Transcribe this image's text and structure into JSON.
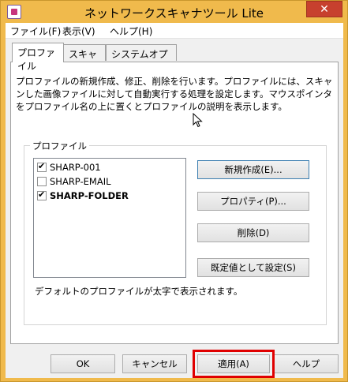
{
  "window": {
    "title": "ネットワークスキャナツール Lite",
    "close_label": "✕"
  },
  "menu": [
    "ファイル(F)",
    "表示(V)",
    "ヘルプ(H)"
  ],
  "tabs": [
    "プロファイル",
    "スキャナ",
    "システムオプション"
  ],
  "profile_tab": {
    "description": "プロファイルの新規作成、修正、削除を行います。プロファイルには、スキャンした画像ファイルに対して自動実行する処理を設定します。マウスポインタをプロファイル名の上に置くとプロファイルの説明を表示します。",
    "group_label": "プロファイル",
    "profiles": [
      {
        "name": "SHARP-001",
        "checked": true,
        "bold": false
      },
      {
        "name": "SHARP-EMAIL",
        "checked": false,
        "bold": false
      },
      {
        "name": "SHARP-FOLDER",
        "checked": true,
        "bold": true
      }
    ],
    "buttons": {
      "new": "新規作成(E)...",
      "properties": "プロパティ(P)...",
      "delete": "削除(D)",
      "set_default": "既定値として設定(S)"
    },
    "note": "デフォルトのプロファイルが太字で表示されます。"
  },
  "dialog_buttons": {
    "ok": "OK",
    "cancel": "キャンセル",
    "apply": "適用(A)",
    "help": "ヘルプ"
  }
}
